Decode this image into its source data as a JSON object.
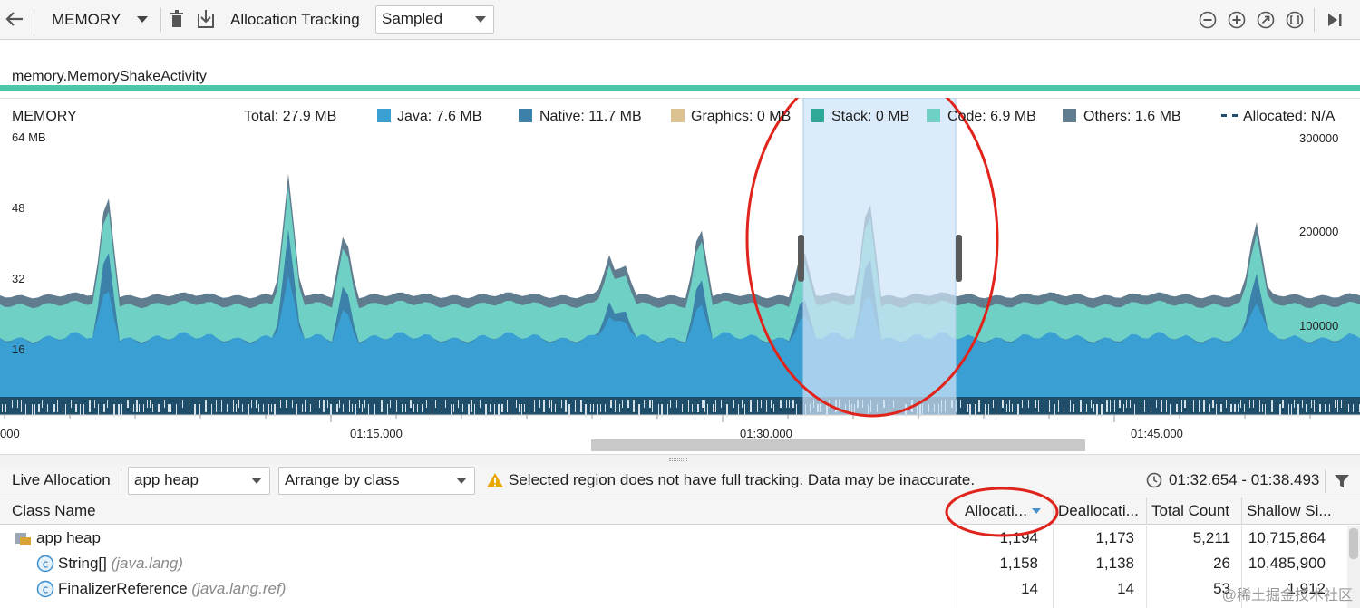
{
  "toolbar": {
    "profiler_label": "MEMORY",
    "allocation_tracking_label": "Allocation Tracking",
    "tracking_mode_value": "Sampled"
  },
  "session": {
    "name": "memory.MemoryShakeActivity"
  },
  "monitor": {
    "title": "MEMORY",
    "total": "Total: 27.9 MB",
    "legend": [
      {
        "label": "Java: 7.6 MB",
        "color": "#3a9fd2"
      },
      {
        "label": "Native: 11.7 MB",
        "color": "#3c81a9"
      },
      {
        "label": "Graphics: 0 MB",
        "color": "#dcc291"
      },
      {
        "label": "Stack: 0 MB",
        "color": "#2fa89a"
      },
      {
        "label": "Code: 6.9 MB",
        "color": "#6fd1c6"
      },
      {
        "label": "Others: 1.6 MB",
        "color": "#607d8f"
      },
      {
        "label": "Allocated: N/A",
        "color": "#1f4e6a"
      }
    ],
    "y_left": [
      "64 MB",
      "48",
      "32",
      "16"
    ],
    "y_right": [
      "300000",
      "200000",
      "100000"
    ],
    "time_ticks": [
      "000",
      "01:15.000",
      "01:30.000",
      "01:45.000"
    ]
  },
  "alloc_panel": {
    "live_allocation_label": "Live Allocation",
    "heap_value": "app heap",
    "arrange_value": "Arrange by class",
    "warning": "Selected region does not have full tracking. Data may be inaccurate.",
    "time_range": "01:32.654 - 01:38.493"
  },
  "table": {
    "columns": [
      "Class Name",
      "Allocati...",
      "Deallocati...",
      "Total Count",
      "Shallow Si..."
    ],
    "rows": [
      {
        "name": "app heap",
        "package": "",
        "allocations": "1,194",
        "deallocations": "1,173",
        "total_count": "5,211",
        "shallow_size": "10,715,864"
      },
      {
        "name": "String[]",
        "package": "(java.lang)",
        "allocations": "1,158",
        "deallocations": "1,138",
        "total_count": "26",
        "shallow_size": "10,485,900"
      },
      {
        "name": "FinalizerReference",
        "package": "(java.lang.ref)",
        "allocations": "14",
        "deallocations": "14",
        "total_count": "53",
        "shallow_size": "1,912"
      }
    ]
  },
  "watermark": "@稀土掘金技术社区",
  "colors": {
    "session_bar": "#4cc8a8",
    "annotation_circle": "#e0241b",
    "selection_fill": "#cfe3f6",
    "warning": "#e6a700"
  }
}
